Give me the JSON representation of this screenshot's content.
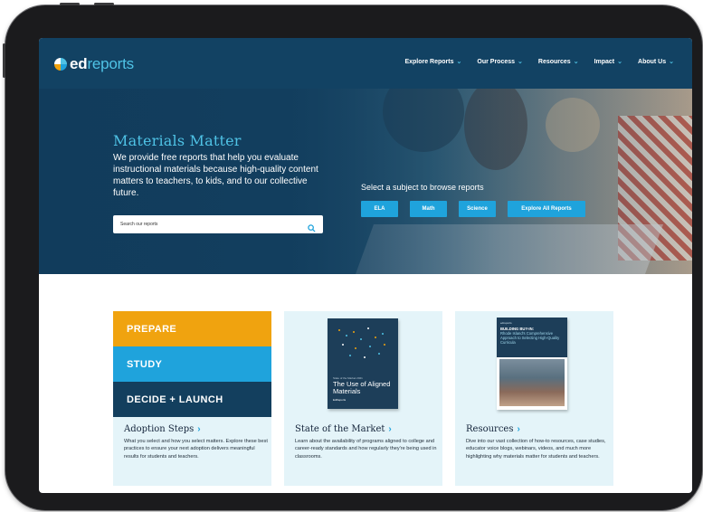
{
  "header": {
    "logo_text_ed": "ed",
    "logo_text_reports": "reports",
    "nav": [
      {
        "label": "Explore Reports"
      },
      {
        "label": "Our Process"
      },
      {
        "label": "Resources"
      },
      {
        "label": "Impact"
      },
      {
        "label": "About Us"
      }
    ]
  },
  "hero": {
    "title": "Materials Matter",
    "text": "We provide free reports that help you evaluate instructional materials because high-quality content matters to teachers, to kids, and to our collective future.",
    "search_placeholder": "Search our reports",
    "subject_prompt": "Select a subject to browse reports",
    "subject_buttons": [
      "ELA",
      "Math",
      "Science",
      "Explore All Reports"
    ]
  },
  "cards": [
    {
      "steps": [
        "PREPARE",
        "STUDY",
        "DECIDE + LAUNCH"
      ],
      "title": "Adoption Steps",
      "body": "What you select and how you select matters. Explore these best practices to ensure your next adoption delivers meaningful results for students and teachers."
    },
    {
      "book_small": "State of the Market 2021",
      "book_title": "The Use of Aligned Materials",
      "book_brand": "EdReports",
      "title": "State of the Market",
      "body": "Learn about the availability of programs aligned to college and career-ready standards and how regularly they're being used in classrooms."
    },
    {
      "report_brand": "edreports",
      "report_head": "BUILDING BUY-IN:",
      "report_text": "Rhode Island's Comprehensive Approach to Selecting High-Quality Curricula",
      "title": "Resources",
      "body": "Dive into our vast collection of how-to resources, case studies, educator voice blogs, webinars, videos, and much more highlighting why materials matter for students and teachers."
    }
  ],
  "colors": {
    "navy": "#124263",
    "accent_blue": "#1fa3dc",
    "light_blue": "#4fc3e6",
    "orange": "#f0a30f",
    "card_bg": "#e4f4f9"
  }
}
